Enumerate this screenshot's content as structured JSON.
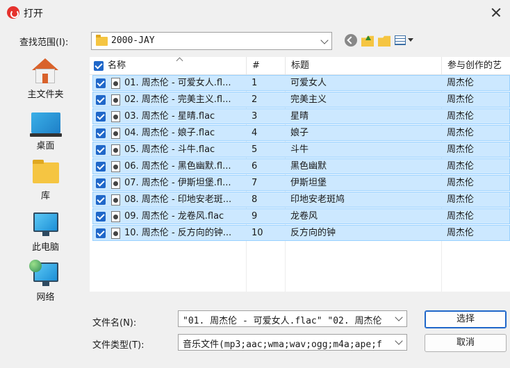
{
  "window": {
    "title": "打开"
  },
  "lookin": {
    "label": "查找范围(I):",
    "value": "2000-JAY"
  },
  "places": [
    {
      "label": "主文件夹",
      "icon": "home-icon"
    },
    {
      "label": "桌面",
      "icon": "desktop-icon"
    },
    {
      "label": "库",
      "icon": "library-folder-icon"
    },
    {
      "label": "此电脑",
      "icon": "computer-icon"
    },
    {
      "label": "网络",
      "icon": "network-icon"
    }
  ],
  "columns": {
    "name": "名称",
    "num": "#",
    "title": "标题",
    "artist": "参与创作的艺"
  },
  "files": [
    {
      "name": "01. 周杰伦 - 可爱女人.fl...",
      "num": "1",
      "title": "可爱女人",
      "artist": "周杰伦"
    },
    {
      "name": "02. 周杰伦 - 完美主义.fl...",
      "num": "2",
      "title": "完美主义",
      "artist": "周杰伦"
    },
    {
      "name": "03. 周杰伦 - 星晴.flac",
      "num": "3",
      "title": "星晴",
      "artist": "周杰伦"
    },
    {
      "name": "04. 周杰伦 - 娘子.flac",
      "num": "4",
      "title": "娘子",
      "artist": "周杰伦"
    },
    {
      "name": "05. 周杰伦 - 斗牛.flac",
      "num": "5",
      "title": "斗牛",
      "artist": "周杰伦"
    },
    {
      "name": "06. 周杰伦 - 黑色幽默.fl...",
      "num": "6",
      "title": "黑色幽默",
      "artist": "周杰伦"
    },
    {
      "name": "07. 周杰伦 - 伊斯坦堡.fl...",
      "num": "7",
      "title": "伊斯坦堡",
      "artist": "周杰伦"
    },
    {
      "name": "08. 周杰伦 - 印地安老斑...",
      "num": "8",
      "title": "印地安老斑鸠",
      "artist": "周杰伦"
    },
    {
      "name": "09. 周杰伦 - 龙卷风.flac",
      "num": "9",
      "title": "龙卷风",
      "artist": "周杰伦"
    },
    {
      "name": "10. 周杰伦 - 反方向的钟...",
      "num": "10",
      "title": "反方向的钟",
      "artist": "周杰伦"
    }
  ],
  "filename": {
    "label": "文件名(N):",
    "value": "\"01. 周杰伦 - 可爱女人.flac\" \"02. 周杰伦"
  },
  "filetype": {
    "label": "文件类型(T):",
    "value": "音乐文件(mp3;aac;wma;wav;ogg;m4a;ape;f"
  },
  "buttons": {
    "select": "选择",
    "cancel": "取消"
  }
}
